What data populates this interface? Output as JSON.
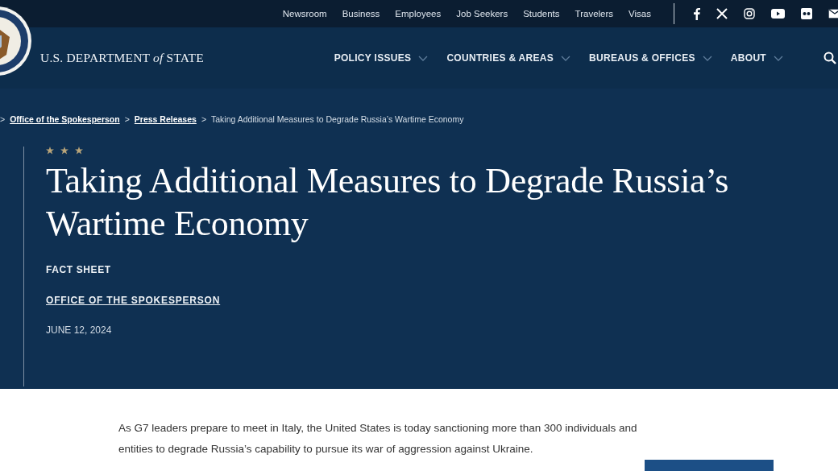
{
  "top_links": [
    "Newsroom",
    "Business",
    "Employees",
    "Job Seekers",
    "Students",
    "Travelers",
    "Visas"
  ],
  "logo": {
    "text": "U.S. DEPARTMENT *of* STATE"
  },
  "main_nav": [
    "POLICY ISSUES",
    "COUNTRIES & AREAS",
    "BUREAUS & OFFICES",
    "ABOUT"
  ],
  "breadcrumb": [
    {
      "separator": ">",
      "label": "Office of the Spokesperson",
      "link": true
    },
    {
      "separator": ">",
      "label": "Press Releases",
      "link": true
    },
    {
      "separator": ">",
      "label": "Taking Additional Measures to Degrade Russia’s Wartime Economy",
      "link": false
    }
  ],
  "article": {
    "title": "Taking Additional Measures to Degrade Russia’s Wartime Economy",
    "type": "FACT SHEET",
    "author": "OFFICE OF THE SPOKESPERSON",
    "date": "JUNE 12, 2024",
    "intro": "As G7 leaders prepare to meet in Italy, the United States is today sanctioning more than 300 individuals and entities to degrade Russia’s capability to pursue its war of aggression against Ukraine."
  }
}
